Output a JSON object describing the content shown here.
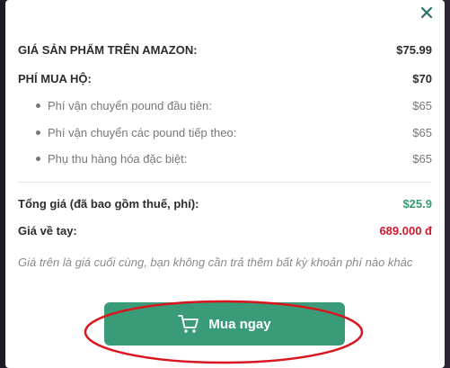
{
  "modal": {
    "close_icon": "close-icon",
    "rows": {
      "amazon_price": {
        "label": "GIÁ SẢN PHẨM TRÊN AMAZON:",
        "value": "$75.99"
      },
      "service_fee": {
        "label": "PHÍ MUA HỘ:",
        "value": "$70"
      },
      "first_pound": {
        "label": "Phí vận chuyển pound đầu tiên:",
        "value": "$65"
      },
      "next_pound": {
        "label": "Phí vận chuyển các pound tiếp theo:",
        "value": "$65"
      },
      "special_surcharge": {
        "label": "Phụ thu hàng hóa đặc biệt:",
        "value": "$65"
      },
      "total": {
        "label": "Tổng giá (đã bao gồm thuế, phí):",
        "value": "$25.9"
      },
      "landed_price": {
        "label": "Giá về tay:",
        "value": "689.000 đ"
      }
    },
    "note": "Giá trên là giá cuối cùng, bạn không cần trả thêm bất kỳ khoản phí nào khác",
    "buy_button": {
      "label": "Mua ngay",
      "icon": "cart-icon"
    }
  },
  "colors": {
    "accent_green": "#3a9b78",
    "price_red": "#d0192f",
    "highlight_red": "#d9151f"
  }
}
